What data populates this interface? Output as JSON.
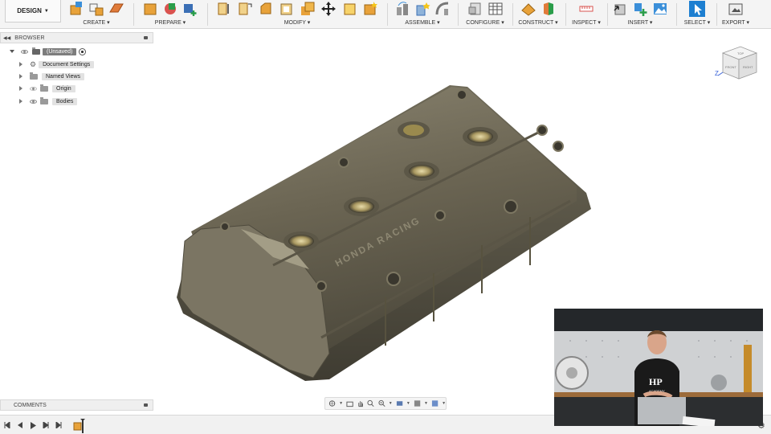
{
  "toolbar": {
    "workspace": "DESIGN",
    "groups": [
      {
        "label": "CREATE ▾"
      },
      {
        "label": "PREPARE ▾"
      },
      {
        "label": "MODIFY ▾"
      },
      {
        "label": "ASSEMBLE ▾"
      },
      {
        "label": "CONFIGURE ▾"
      },
      {
        "label": "CONSTRUCT ▾"
      },
      {
        "label": "INSPECT ▾"
      },
      {
        "label": "INSERT ▾"
      },
      {
        "label": "SELECT ▾"
      },
      {
        "label": "EXPORT ▾"
      }
    ]
  },
  "browser": {
    "title": "BROWSER",
    "items": [
      {
        "label": "(Unsaved)"
      },
      {
        "label": "Document Settings"
      },
      {
        "label": "Named Views"
      },
      {
        "label": "Origin"
      },
      {
        "label": "Bodies"
      }
    ]
  },
  "comments": {
    "title": "COMMENTS"
  },
  "viewcube": {
    "top": "TOP",
    "front": "FRONT",
    "right": "RIGHT",
    "axis": "Z"
  },
  "model": {
    "brand_text": "HONDA RACING"
  },
  "webcam": {
    "shirt_logo": "HP",
    "shirt_sub": "ACADEMY"
  },
  "colors": {
    "accent": "#0696d7",
    "model": "#6b6553",
    "select_blue": "#1d7fd1"
  }
}
